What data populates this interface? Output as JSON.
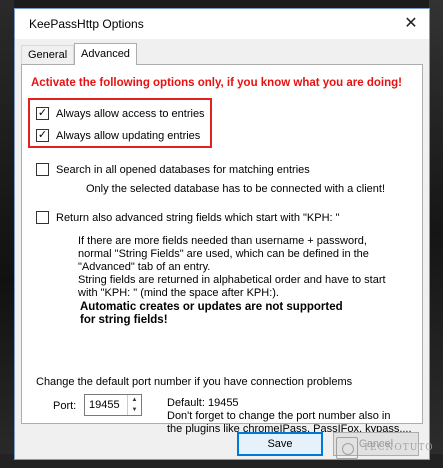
{
  "window": {
    "title": "KeePassHttp Options"
  },
  "tabs": [
    {
      "label": "General",
      "active": false
    },
    {
      "label": "Advanced",
      "active": true
    }
  ],
  "warning": "Activate the following options only, if you know what you are doing!",
  "options": {
    "allow_access": {
      "label": "Always allow access to entries",
      "checked": true
    },
    "allow_updating": {
      "label": "Always allow updating entries",
      "checked": true
    },
    "search_all": {
      "label": "Search in all opened databases for matching entries",
      "checked": false,
      "note": "Only the selected database has to be connected with a client!"
    },
    "string_fields": {
      "label": "Return also advanced string fields which start with \"KPH: \"",
      "checked": false,
      "note_lines": [
        "If there are more fields needed than username + password,",
        "normal \"String Fields\" are used, which can be defined in the",
        "\"Advanced\" tab of an entry.",
        "String fields are returned in alphabetical order and have to start",
        "with \"KPH: \" (mind the space after KPH:)."
      ],
      "warning_lines": [
        "Automatic creates or updates are not supported",
        "for string fields!"
      ]
    }
  },
  "port": {
    "section_label": "Change the default port number if you have connection problems",
    "label": "Port:",
    "value": "19455",
    "default_text": "Default: 19455",
    "note_lines": [
      "Don't forget to change the port number also in",
      "the plugins like chromeIPass, PassIFox, kypass,..."
    ]
  },
  "buttons": {
    "save": "Save",
    "cancel": "Cancel"
  },
  "watermark": "TECNOTUTO",
  "icons": {
    "check": "✓",
    "close": "✕",
    "spin_up": "▲",
    "spin_down": "▼"
  }
}
